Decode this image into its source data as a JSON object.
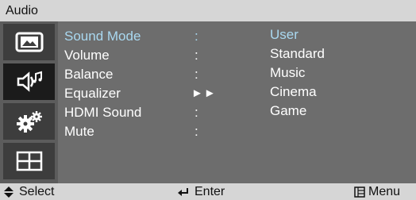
{
  "window": {
    "title": "Audio"
  },
  "sidebar": {
    "items": [
      {
        "icon": "picture-icon"
      },
      {
        "icon": "sound-icon",
        "active": true
      },
      {
        "icon": "setup-gears-icon"
      },
      {
        "icon": "input-grid-icon"
      }
    ]
  },
  "menu": {
    "rows": [
      {
        "label": "Sound Mode",
        "sep": ":"
      },
      {
        "label": "Volume",
        "sep": ":"
      },
      {
        "label": "Balance",
        "sep": ":"
      },
      {
        "label": "Equalizer",
        "sep": "►►"
      },
      {
        "label": "HDMI Sound",
        "sep": ":"
      },
      {
        "label": "Mute",
        "sep": ":"
      }
    ],
    "options": [
      "User",
      "Standard",
      "Music",
      "Cinema",
      "Game"
    ]
  },
  "footer": {
    "select_label": "Select",
    "enter_label": "Enter",
    "menu_label": "Menu"
  },
  "colors": {
    "highlight": "#a9d8f0",
    "bar": "#d6d6d6"
  }
}
